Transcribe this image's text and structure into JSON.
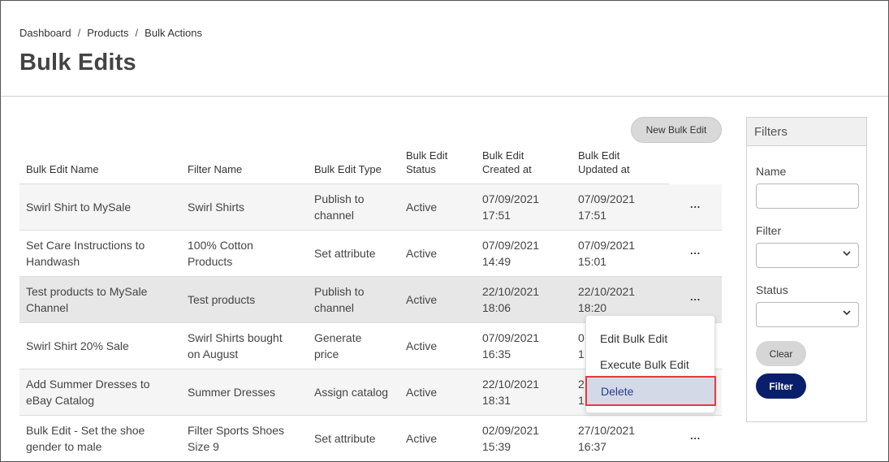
{
  "breadcrumb": [
    "Dashboard",
    "Products",
    "Bulk Actions"
  ],
  "breadcrumb_separator": "/",
  "page_title": "Bulk Edits",
  "new_button_label": "New Bulk Edit",
  "table": {
    "headers": {
      "name": "Bulk Edit Name",
      "filter": "Filter Name",
      "type": "Bulk Edit Type",
      "status_1": "Bulk Edit",
      "status_2": "Status",
      "created_1": "Bulk Edit",
      "created_2": "Created at",
      "updated_1": "Bulk Edit",
      "updated_2": "Updated at"
    },
    "rows": [
      {
        "name_1": "Swirl Shirt to MySale",
        "name_2": "",
        "filter_1": "Swirl Shirts",
        "filter_2": "",
        "type_1": "Publish to",
        "type_2": "channel",
        "status": "Active",
        "created_1": "07/09/2021",
        "created_2": "17:51",
        "updated_1": "07/09/2021",
        "updated_2": "17:51"
      },
      {
        "name_1": "Set Care Instructions to",
        "name_2": "Handwash",
        "filter_1": "100% Cotton",
        "filter_2": "Products",
        "type_1": "Set attribute",
        "type_2": "",
        "status": "Active",
        "created_1": "07/09/2021",
        "created_2": "14:49",
        "updated_1": "07/09/2021",
        "updated_2": "15:01"
      },
      {
        "name_1": "Test products to MySale",
        "name_2": "Channel",
        "filter_1": "Test products",
        "filter_2": "",
        "type_1": "Publish to",
        "type_2": "channel",
        "status": "Active",
        "created_1": "22/10/2021",
        "created_2": "18:06",
        "updated_1": "22/10/2021",
        "updated_2": "18:20"
      },
      {
        "name_1": "Swirl Shirt 20% Sale",
        "name_2": "",
        "filter_1": "Swirl Shirts bought",
        "filter_2": "on August",
        "type_1": "Generate",
        "type_2": "price",
        "status": "Active",
        "created_1": "07/09/2021",
        "created_2": "16:35",
        "updated_1": "0",
        "updated_2": "1"
      },
      {
        "name_1": "Add Summer Dresses to",
        "name_2": "eBay Catalog",
        "filter_1": "Summer Dresses",
        "filter_2": "",
        "type_1": "Assign catalog",
        "type_2": "",
        "status": "Active",
        "created_1": "22/10/2021",
        "created_2": "18:31",
        "updated_1": "2",
        "updated_2": "1"
      },
      {
        "name_1": "Bulk Edit - Set the shoe",
        "name_2": "gender to male",
        "filter_1": "Filter Sports Shoes",
        "filter_2": "Size 9",
        "type_1": "Set attribute",
        "type_2": "",
        "status": "Active",
        "created_1": "02/09/2021",
        "created_2": "15:39",
        "updated_1": "27/10/2021",
        "updated_2": "16:37"
      }
    ],
    "row_menu_label": "···"
  },
  "context_menu": {
    "edit": "Edit Bulk Edit",
    "execute": "Execute Bulk Edit",
    "delete": "Delete"
  },
  "filters": {
    "title": "Filters",
    "name_label": "Name",
    "name_value": "",
    "filter_label": "Filter",
    "filter_value": "",
    "status_label": "Status",
    "status_value": "",
    "clear_label": "Clear",
    "filter_button_label": "Filter"
  },
  "colors": {
    "primary_button": "#0a1f6b",
    "highlight_border": "#e03c3c",
    "menu_highlight_bg": "#d4d9e8"
  }
}
